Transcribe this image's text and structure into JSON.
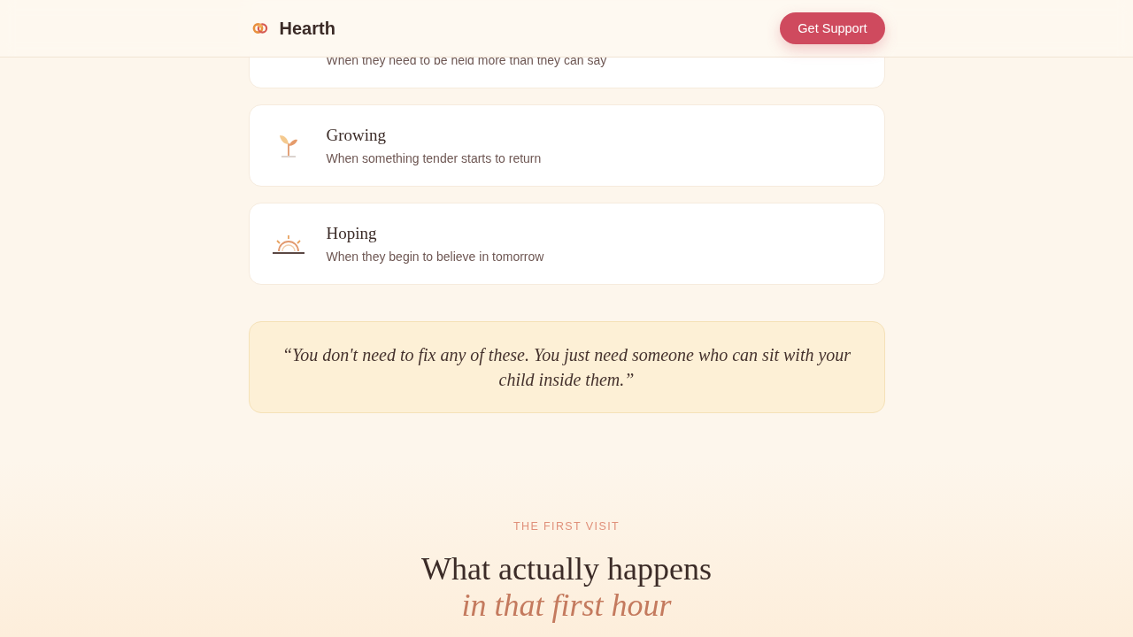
{
  "header": {
    "brand": "Hearth",
    "button": "Get Support"
  },
  "feelings": [
    {
      "kind": "covered",
      "description": "When they need to be held more than they can say"
    },
    {
      "kind": "sprout",
      "title": "Growing",
      "description": "When something tender starts to return"
    },
    {
      "kind": "sunrise",
      "title": "Hoping",
      "description": "When they begin to believe in tomorrow"
    }
  ],
  "quote": "“You don't need to fix any of these. You just need someone who can sit with your child inside them.”",
  "next_section": {
    "eyebrow": "THE FIRST VISIT",
    "heading": "What actually happens",
    "heading_accent": "in that first hour"
  }
}
